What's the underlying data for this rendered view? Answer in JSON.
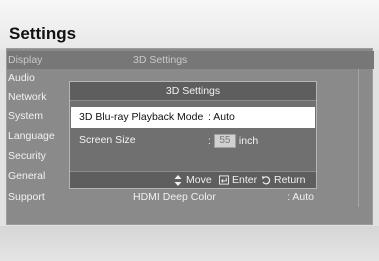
{
  "page": {
    "title": "Settings"
  },
  "menu": {
    "items": [
      {
        "label": "Display"
      },
      {
        "label": "Audio"
      },
      {
        "label": "Network"
      },
      {
        "label": "System"
      },
      {
        "label": "Language"
      },
      {
        "label": "Security"
      },
      {
        "label": "General"
      },
      {
        "label": "Support"
      }
    ]
  },
  "background_rows": [
    {
      "label": "3D Settings",
      "value": ""
    },
    {
      "label": "HDMI Deep Color",
      "value": ": Auto"
    }
  ],
  "dialog": {
    "title": "3D Settings",
    "rows": [
      {
        "label": "3D Blu-ray Playback Mode",
        "value": ": Auto",
        "selected": true
      },
      {
        "label": "Screen Size",
        "prefix": ":",
        "value": "55",
        "unit": "inch",
        "selected": false
      }
    ],
    "footer": [
      {
        "icon": "up-down-arrow-icon",
        "label": "Move"
      },
      {
        "icon": "enter-icon",
        "label": "Enter"
      },
      {
        "icon": "return-icon",
        "label": "Return"
      }
    ]
  },
  "colors": {
    "selected_row": "#ffffff",
    "panel": "#8a8a8a",
    "dialog": "#707070"
  }
}
